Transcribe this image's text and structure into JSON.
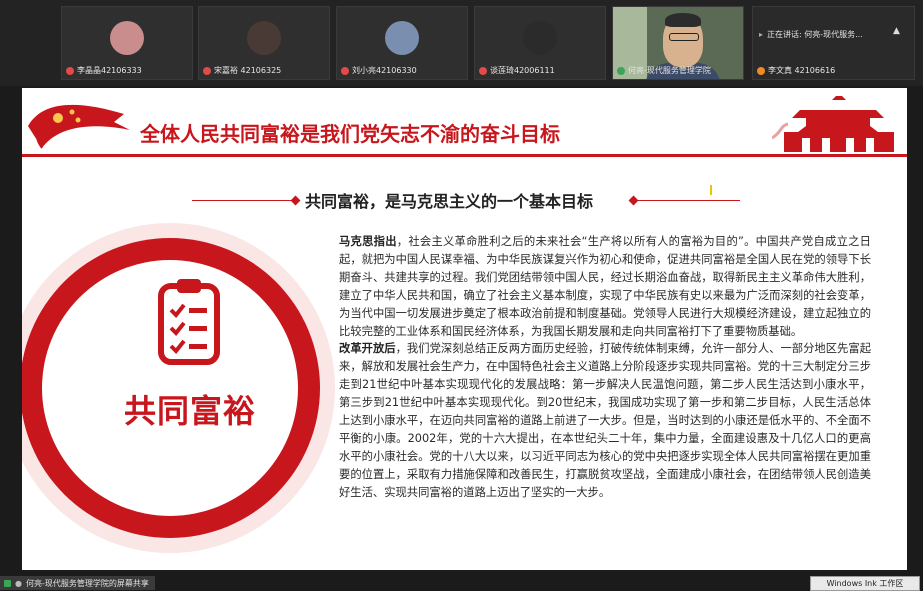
{
  "participants": [
    {
      "name": "李晶晶42106333"
    },
    {
      "name": "宋嘉裕 42106325"
    },
    {
      "name": "刘小亮42106330"
    },
    {
      "name": "谈莲琦42006111"
    },
    {
      "name": "何亮-现代服务管理学院"
    },
    {
      "name": "李文真 42106616"
    }
  ],
  "speaking": {
    "text": "正在讲话: 何亮-现代服务..."
  },
  "slide": {
    "title": "全体人民共同富裕是我们党矢志不渝的奋斗目标",
    "subtitle": "共同富裕，是马克思主义的一个基本目标",
    "badge_text": "共同富裕",
    "p1_lead": "马克思指出",
    "p1_text": "，社会主义革命胜利之后的未来社会“生产将以所有人的富裕为目的”。中国共产党自成立之日起，就把为中国人民谋幸福、为中华民族谋复兴作为初心和使命，促进共同富裕是全国人民在党的领导下长期奋斗、共建共享的过程。我们党团结带领中国人民，经过长期浴血奋战，取得新民主主义革命伟大胜利，建立了中华人民共和国，确立了社会主义基本制度，实现了中华民族有史以来最为广泛而深刻的社会变革，为当代中国一切发展进步奠定了根本政治前提和制度基础。党领导人民进行大规模经济建设，建立起独立的比较完整的工业体系和国民经济体系，为我国长期发展和走向共同富裕打下了重要物质基础。",
    "p2_lead": "改革开放后",
    "p2_text": "，我们党深刻总结正反两方面历史经验，打破传统体制束缚，允许一部分人、一部分地区先富起来，解放和发展社会生产力，在中国特色社会主义道路上分阶段逐步实现共同富裕。党的十三大制定分三步走到21世纪中叶基本实现现代化的发展战略：第一步解决人民温饱问题，第二步人民生活达到小康水平，第三步到21世纪中叶基本实现现代化。到20世纪末，我国成功实现了第一步和第二步目标，人民生活总体上达到小康水平，在迈向共同富裕的道路上前进了一大步。但是，当时达到的小康还是低水平的、不全面不平衡的小康。2002年，党的十六大提出，在本世纪头二十年，集中力量，全面建设惠及十几亿人口的更高水平的小康社会。党的十八大以来，以习近平同志为核心的党中央把逐步实现全体人民共同富裕摆在更加重要的位置上，采取有力措施保障和改善民生，打赢脱贫攻坚战，全面建成小康社会，在团结带领人民创造美好生活、实现共同富裕的道路上迈出了坚实的一大步。"
  },
  "bottom": {
    "share_label": "何亮-现代服务管理学院的屏幕共享",
    "ink_label": "Windows Ink 工作区"
  },
  "colors": {
    "accent_red": "#c8161d"
  }
}
